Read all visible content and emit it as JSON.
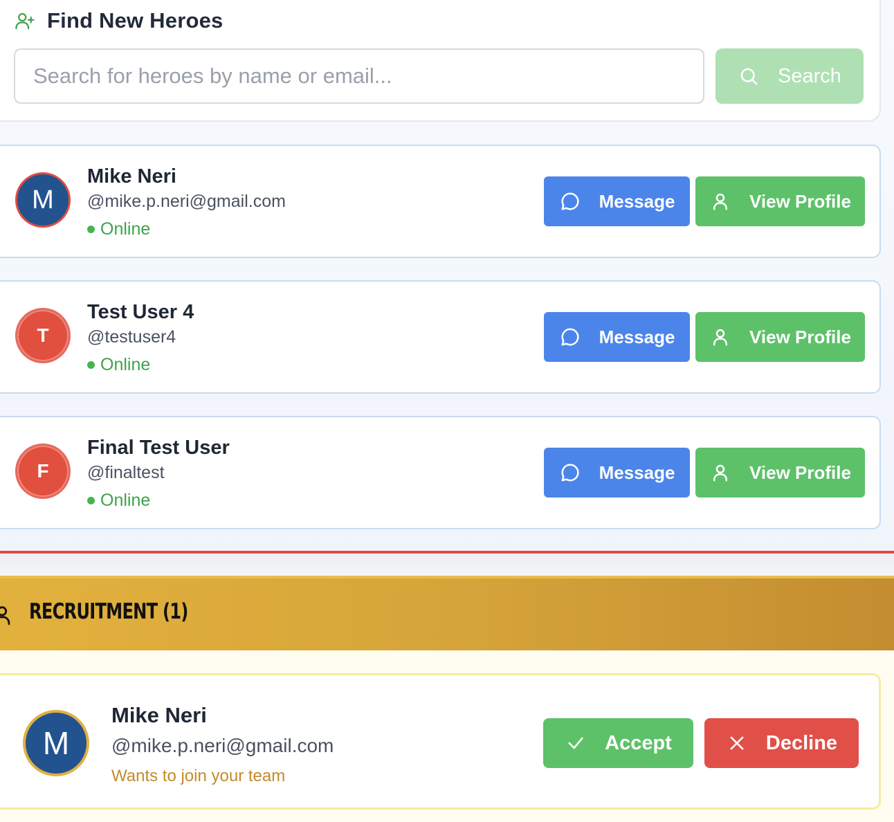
{
  "find": {
    "title": "Find New Heroes",
    "icon": "user-plus-icon",
    "search_placeholder": "Search for heroes by name or email...",
    "search_value": "",
    "search_button": "Search"
  },
  "heroes": [
    {
      "initial": "M",
      "name": "Mike Neri",
      "handle": "@mike.p.neri@gmail.com",
      "status": "Online",
      "message_label": "Message",
      "profile_label": "View Profile"
    },
    {
      "initial": "T",
      "name": "Test User 4",
      "handle": "@testuser4",
      "status": "Online",
      "message_label": "Message",
      "profile_label": "View Profile"
    },
    {
      "initial": "F",
      "name": "Final Test User",
      "handle": "@finaltest",
      "status": "Online",
      "message_label": "Message",
      "profile_label": "View Profile"
    }
  ],
  "recruitment": {
    "title": "RECRUITMENT (1)",
    "icon": "user-icon",
    "requests": [
      {
        "initial": "M",
        "name": "Mike Neri",
        "handle": "@mike.p.neri@gmail.com",
        "note": "Wants to join your team",
        "accept_label": "Accept",
        "decline_label": "Decline"
      }
    ]
  },
  "colors": {
    "message_blue": "#4b85ea",
    "profile_green": "#5dc16a",
    "decline_red": "#e05049",
    "recruit_gold": "#d6a53a",
    "online_green": "#3fa24b"
  }
}
